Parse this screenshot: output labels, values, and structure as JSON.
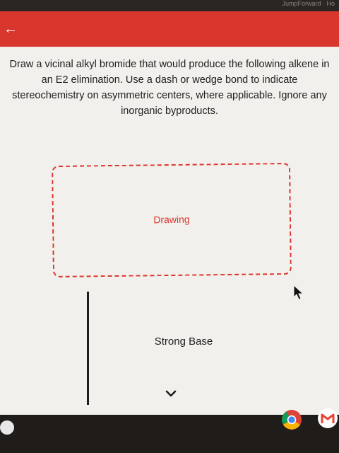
{
  "topbar": {
    "text": "JumpForward · Ho"
  },
  "header": {
    "back_icon": "arrow-left-icon",
    "color": "#d9372e"
  },
  "question": {
    "prompt": "Draw a vicinal alkyl bromide that would produce the following alkene in an E2 elimination. Use a dash or wedge bond to indicate stereochemistry on asymmetric centers, where applicable. Ignore any inorganic byproducts."
  },
  "drawing": {
    "label": "Drawing"
  },
  "reaction": {
    "reagent": "Strong Base",
    "expand_icon": "chevron-down-icon"
  },
  "shelf": {
    "apps": [
      "launcher-icon",
      "chrome-icon",
      "gmail-icon"
    ]
  }
}
